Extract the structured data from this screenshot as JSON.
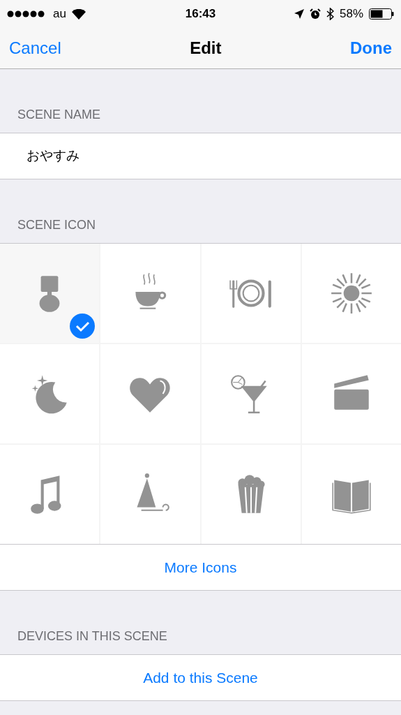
{
  "status_bar": {
    "carrier": "au",
    "time": "16:43",
    "battery": "58%"
  },
  "nav": {
    "cancel": "Cancel",
    "title": "Edit",
    "done": "Done"
  },
  "scene_name": {
    "header": "SCENE NAME",
    "value": "おやすみ"
  },
  "scene_icon": {
    "header": "SCENE ICON",
    "icons": [
      {
        "kind": "lamp",
        "selected": true
      },
      {
        "kind": "cup",
        "selected": false
      },
      {
        "kind": "plate",
        "selected": false
      },
      {
        "kind": "sun",
        "selected": false
      },
      {
        "kind": "moon",
        "selected": false
      },
      {
        "kind": "heart",
        "selected": false
      },
      {
        "kind": "cocktail",
        "selected": false
      },
      {
        "kind": "clapper",
        "selected": false
      },
      {
        "kind": "note",
        "selected": false
      },
      {
        "kind": "hat",
        "selected": false
      },
      {
        "kind": "popcorn",
        "selected": false
      },
      {
        "kind": "book",
        "selected": false
      }
    ],
    "more": "More Icons"
  },
  "devices": {
    "header": "DEVICES IN THIS SCENE",
    "add": "Add to this Scene"
  }
}
